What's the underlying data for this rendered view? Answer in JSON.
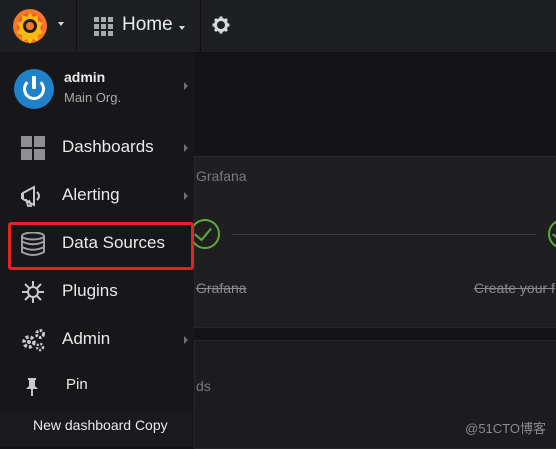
{
  "topbar": {
    "home_label": "Home",
    "logo_icon": "grafana-logo-icon",
    "settings_icon": "gear-icon"
  },
  "profile": {
    "name": "admin",
    "org": "Main Org."
  },
  "sidemenu": {
    "items": [
      {
        "label": "Dashboards",
        "icon": "dashboards-grid-icon"
      },
      {
        "label": "Alerting",
        "icon": "megaphone-icon"
      },
      {
        "label": "Data Sources",
        "icon": "database-icon"
      },
      {
        "label": "Plugins",
        "icon": "plugin-icon"
      },
      {
        "label": "Admin",
        "icon": "gears-icon"
      },
      {
        "label": "Pin",
        "icon": "pin-icon"
      }
    ]
  },
  "background": {
    "panel_heading": "Grafana",
    "step1_label": "Grafana",
    "step2_label": "Create your f",
    "list_label": "ds",
    "dashboard_link": "New dashboard Copy"
  },
  "watermark": "@51CTO博客",
  "colors": {
    "accent_highlight": "#e02424",
    "avatar": "#1f82c9",
    "check": "#5aab3c"
  }
}
